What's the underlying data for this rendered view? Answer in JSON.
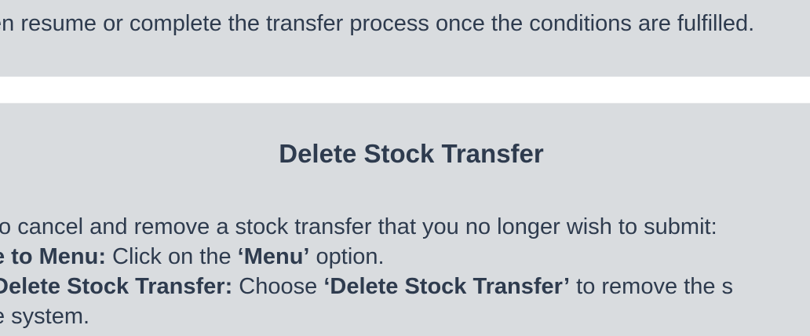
{
  "top_section": {
    "text": "en resume or complete the transfer process once the conditions are fulfilled."
  },
  "delete_section": {
    "title": "Delete Stock Transfer",
    "intro": "to cancel and remove a stock transfer that you no longer wish to submit:",
    "step1": {
      "label": "e to Menu:",
      "text_before": " Click on the ",
      "highlight": "‘Menu’",
      "text_after": " option."
    },
    "step2": {
      "label": "Delete Stock Transfer:",
      "text_before": " Choose ",
      "highlight": "‘Delete Stock Transfer’",
      "text_after": " to remove the s"
    },
    "step2_continued": "e system."
  }
}
